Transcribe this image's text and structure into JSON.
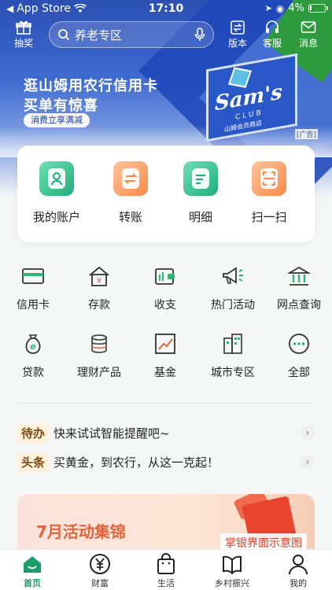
{
  "status_bar": {
    "carrier": "App Store",
    "time": "17:10",
    "battery": "4%"
  },
  "top_nav": {
    "lottery_label": "抽奖",
    "search_placeholder": "养老专区",
    "version_label": "版本",
    "service_label": "客服",
    "message_label": "消息"
  },
  "banner": {
    "line1": "逛山姆用农行信用卡",
    "line2": "买单有惊喜",
    "pill": "消费立享满减",
    "brand": "Sam's",
    "brand_sub": "CLUB",
    "brand_store": "山姆会员商店",
    "ad_tag": "[广告]"
  },
  "quick_actions": [
    {
      "label": "我的账户"
    },
    {
      "label": "转账"
    },
    {
      "label": "明细"
    },
    {
      "label": "扫一扫"
    }
  ],
  "services": [
    {
      "label": "信用卡",
      "icon": "credit-card-icon"
    },
    {
      "label": "存款",
      "icon": "deposit-house-icon"
    },
    {
      "label": "收支",
      "icon": "wallet-icon"
    },
    {
      "label": "热门活动",
      "icon": "megaphone-icon"
    },
    {
      "label": "网点查询",
      "icon": "bank-building-icon"
    },
    {
      "label": "贷款",
      "icon": "money-bag-icon"
    },
    {
      "label": "理财产品",
      "icon": "coin-stack-icon"
    },
    {
      "label": "基金",
      "icon": "trend-chart-icon"
    },
    {
      "label": "城市专区",
      "icon": "city-buildings-icon"
    },
    {
      "label": "全部",
      "icon": "more-dots-icon"
    }
  ],
  "notices": [
    {
      "tag": "待办",
      "text": "快来试试智能提醒吧~"
    },
    {
      "tag": "头条",
      "text": "买黄金，到农行，从这一克起！"
    }
  ],
  "promo": {
    "title": "7月活动集锦"
  },
  "watermark": "掌银界面示意图",
  "tabs": [
    {
      "label": "首页",
      "active": true
    },
    {
      "label": "财富"
    },
    {
      "label": "生活"
    },
    {
      "label": "乡村振兴"
    },
    {
      "label": "我的"
    }
  ],
  "colors": {
    "brand_green": "#1b9e6a",
    "banner_blue": "#2b4fb3",
    "accent_orange": "#f88a4b"
  }
}
